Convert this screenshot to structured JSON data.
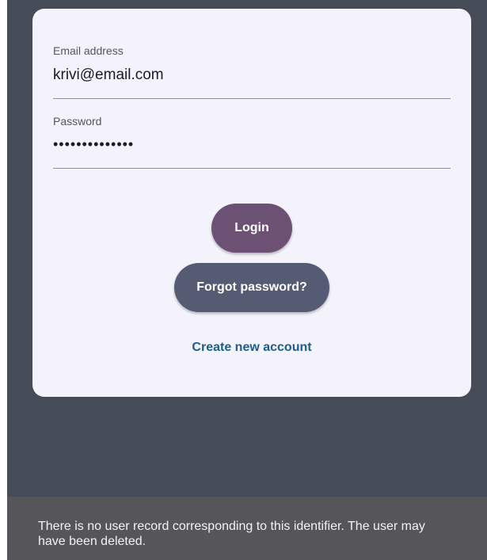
{
  "login_form": {
    "email": {
      "label": "Email address",
      "value": "krivi@email.com"
    },
    "password": {
      "label": "Password",
      "masked_value": "••••••••••••••"
    },
    "login_button": "Login",
    "forgot_password_button": "Forgot password?",
    "create_account_link": "Create new account"
  },
  "snackbar": {
    "message": "There is no user record corresponding to this identifier. The user may have been deleted."
  },
  "colors": {
    "screen_background": "#464b58",
    "card_background": "#f4f3fb",
    "login_button": "#6c5174",
    "forgot_button": "#555b72",
    "link": "#1a5f8e",
    "snackbar_background": "#56565a"
  }
}
